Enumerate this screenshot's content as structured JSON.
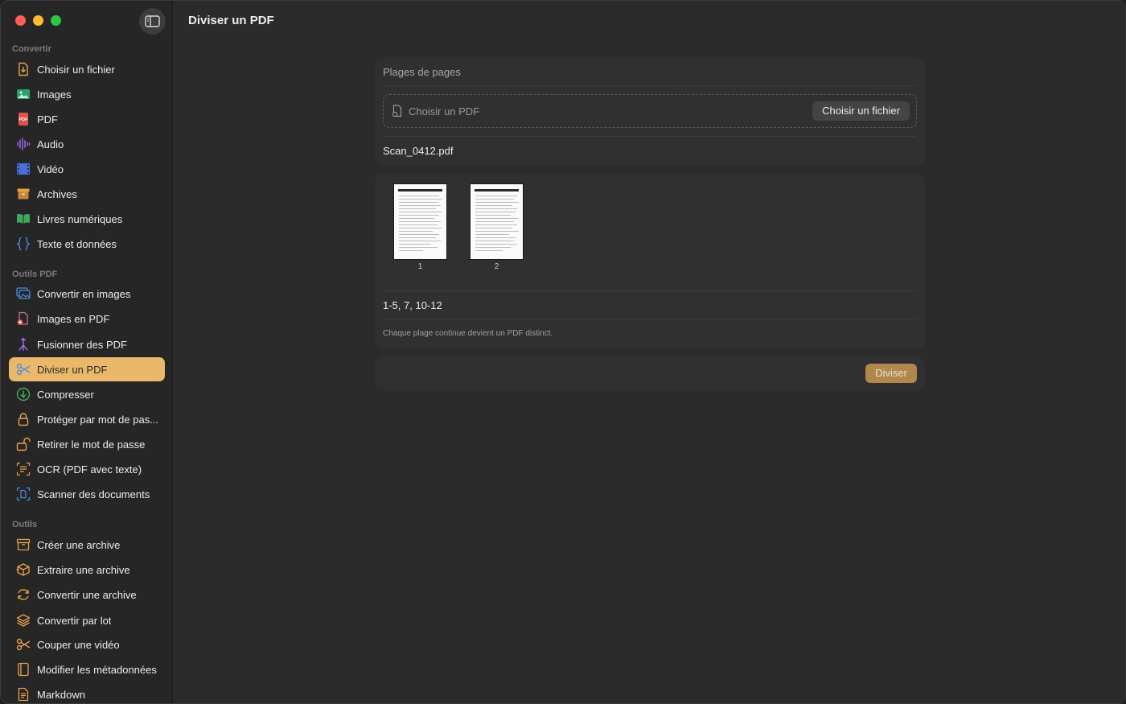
{
  "window": {
    "title": "Diviser un PDF"
  },
  "sidebar": {
    "sections": [
      {
        "title": "Convertir"
      },
      {
        "title": "Outils PDF"
      },
      {
        "title": "Outils"
      }
    ],
    "items": [
      {
        "label": "Choisir un fichier",
        "icon": "doc-download-icon"
      },
      {
        "label": "Images",
        "icon": "photo-icon"
      },
      {
        "label": "PDF",
        "icon": "pdf-icon"
      },
      {
        "label": "Audio",
        "icon": "waveform-icon"
      },
      {
        "label": "Vidéo",
        "icon": "film-icon"
      },
      {
        "label": "Archives",
        "icon": "archive-box-icon"
      },
      {
        "label": "Livres numériques",
        "icon": "book-icon"
      },
      {
        "label": "Texte et données",
        "icon": "braces-icon"
      },
      {
        "label": "Convertir en images",
        "icon": "photos-stack-icon"
      },
      {
        "label": "Images en PDF",
        "icon": "doc-plus-icon"
      },
      {
        "label": "Fusionner des PDF",
        "icon": "merge-arrow-icon"
      },
      {
        "label": "Diviser un PDF",
        "icon": "scissors-icon"
      },
      {
        "label": "Compresser",
        "icon": "arrow-down-circle-icon"
      },
      {
        "label": "Protéger par mot de pas...",
        "icon": "lock-icon"
      },
      {
        "label": "Retirer le mot de passe",
        "icon": "unlock-icon"
      },
      {
        "label": "OCR (PDF avec texte)",
        "icon": "text-viewfinder-icon"
      },
      {
        "label": "Scanner des documents",
        "icon": "doc-viewfinder-icon"
      },
      {
        "label": "Créer une archive",
        "icon": "archive-box-icon"
      },
      {
        "label": "Extraire une archive",
        "icon": "shipping-box-icon"
      },
      {
        "label": "Convertir une archive",
        "icon": "arrows-circle-icon"
      },
      {
        "label": "Convertir par lot",
        "icon": "layers-icon"
      },
      {
        "label": "Couper une vidéo",
        "icon": "scissors-icon"
      },
      {
        "label": "Modifier les métadonnées",
        "icon": "book-closed-icon"
      },
      {
        "label": "Markdown",
        "icon": "doc-text-icon"
      }
    ],
    "active_item": "Diviser un PDF"
  },
  "page_ranges": {
    "label": "Plages de pages",
    "dropzone_text": "Choisir un PDF",
    "choose_button": "Choisir un fichier",
    "file_name": "Scan_0412.pdf"
  },
  "preview": {
    "pages": [
      "1",
      "2"
    ],
    "ranges_value": "1-5, 7, 10-12",
    "hint": "Chaque plage continue devient un PDF distinct."
  },
  "actions": {
    "split_button": "Diviser"
  },
  "colors": {
    "accent": "#e9b86a",
    "split_button": "#b0884d",
    "orange_icon": "#e8a04a",
    "green_icon": "#4caf50",
    "blue_icon": "#4a8fe0",
    "purple_icon": "#9a6cf0",
    "red_icon": "#e0524a"
  }
}
